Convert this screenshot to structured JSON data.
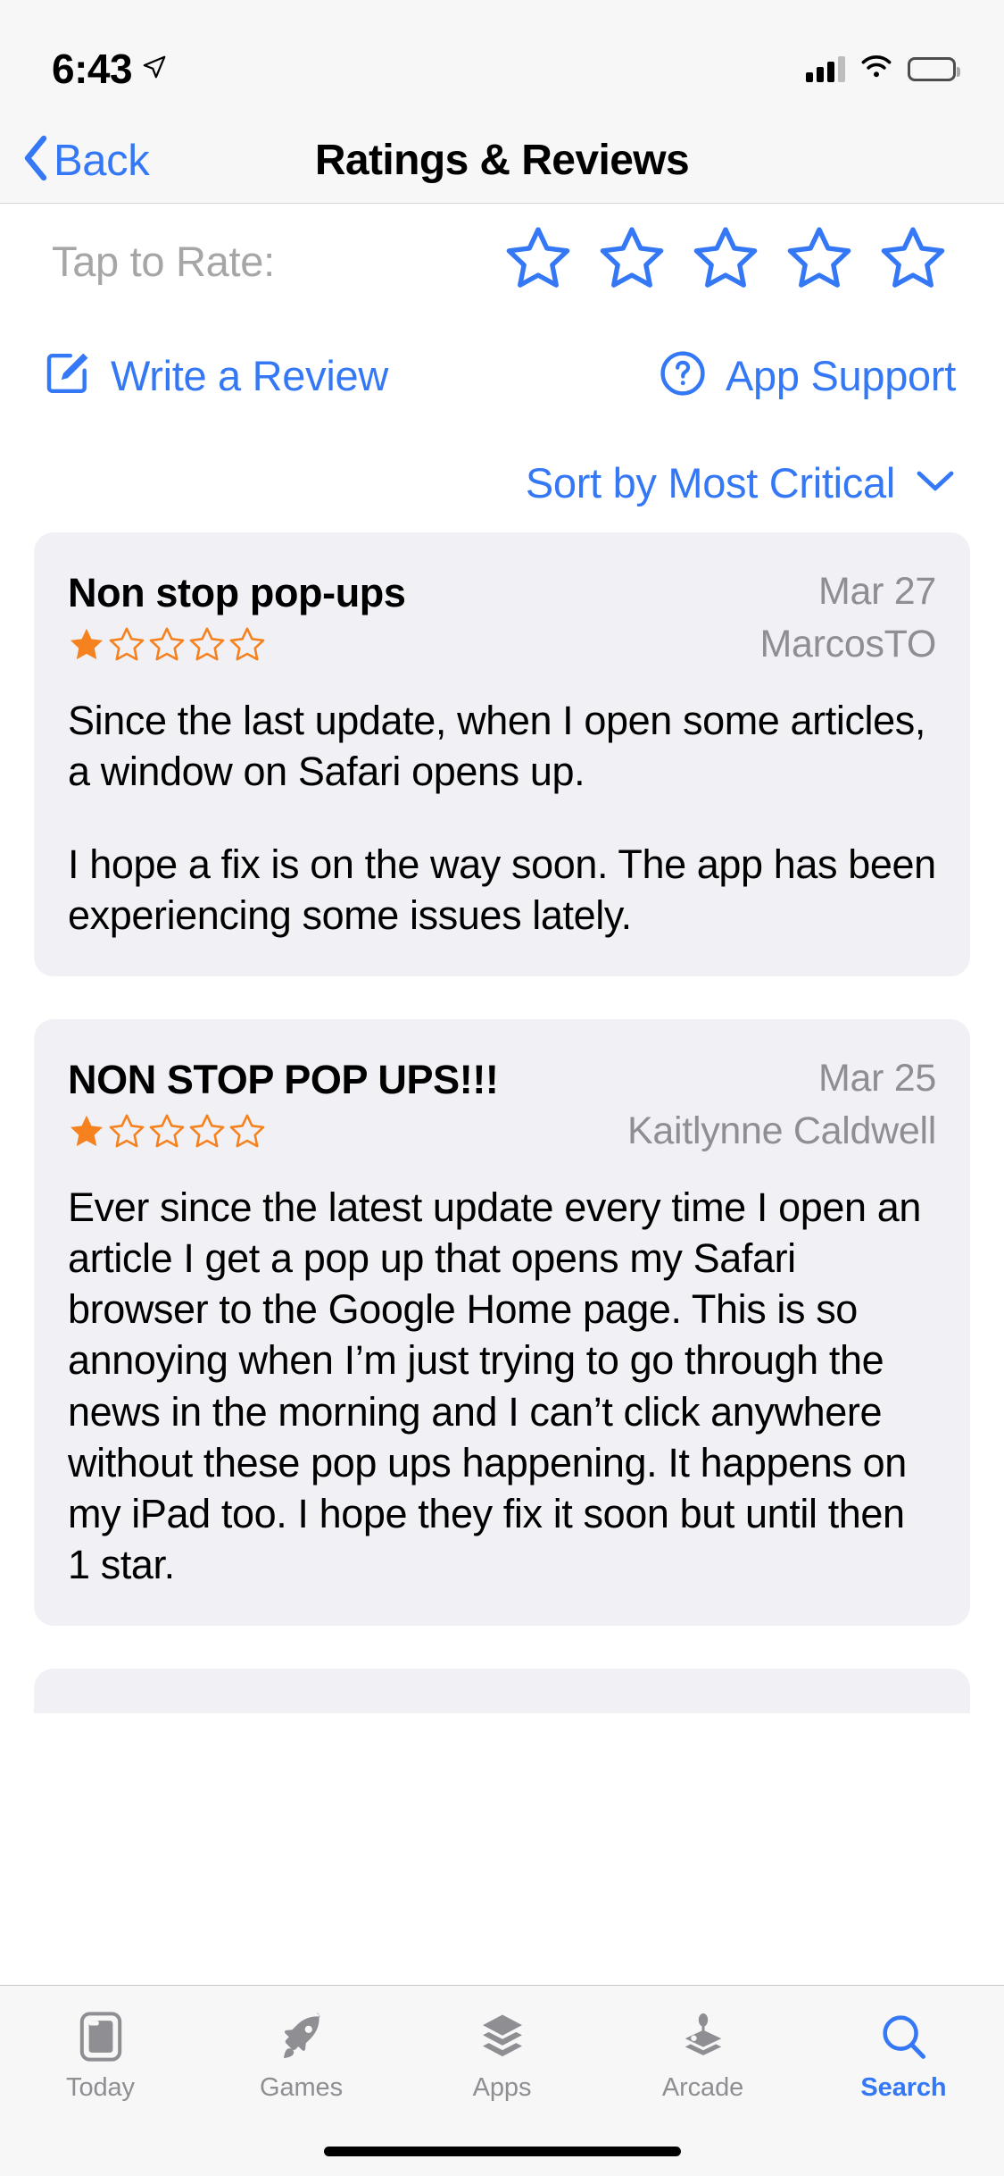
{
  "status_bar": {
    "time": "6:43",
    "location_icon": "location-arrow-icon",
    "signal_icon": "cellular-signal-icon",
    "wifi_icon": "wifi-icon",
    "battery_icon": "battery-icon"
  },
  "nav": {
    "back_label": "Back",
    "title": "Ratings & Reviews"
  },
  "rate": {
    "label": "Tap to Rate:",
    "stars": 5,
    "filled": 0
  },
  "actions": {
    "write_review_label": "Write a Review",
    "app_support_label": "App Support"
  },
  "sort": {
    "label": "Sort by Most Critical"
  },
  "reviews": [
    {
      "title": "Non stop pop-ups",
      "date": "Mar 27",
      "user": "MarcosTO",
      "rating": 1,
      "paragraphs": [
        "Since the last update, when I open some articles, a window on Safari opens up.",
        "I hope a fix is on the way soon. The app has been experiencing some issues lately."
      ]
    },
    {
      "title": "NON STOP POP UPS!!!",
      "date": "Mar 25",
      "user": "Kaitlynne Caldwell",
      "rating": 1,
      "paragraphs": [
        "Ever since the latest update every time I open an article I get a pop up that opens my Safari browser to the Google Home page. This is so annoying when I’m just trying to go through the news in the morning and I can’t click anywhere without these pop ups happening. It happens on my iPad too. I hope they fix it soon but until then 1 star."
      ]
    }
  ],
  "tabs": [
    {
      "label": "Today",
      "icon": "today-card-icon",
      "active": false
    },
    {
      "label": "Games",
      "icon": "rocket-icon",
      "active": false
    },
    {
      "label": "Apps",
      "icon": "apps-stack-icon",
      "active": false
    },
    {
      "label": "Arcade",
      "icon": "joystick-icon",
      "active": false
    },
    {
      "label": "Search",
      "icon": "search-icon",
      "active": true
    }
  ],
  "colors": {
    "accent": "#3478f6",
    "star_filled": "#f5821f",
    "card_bg": "#f1f1f5",
    "secondary_text": "#8e8e93",
    "bar_bg": "#f7f7f7"
  }
}
